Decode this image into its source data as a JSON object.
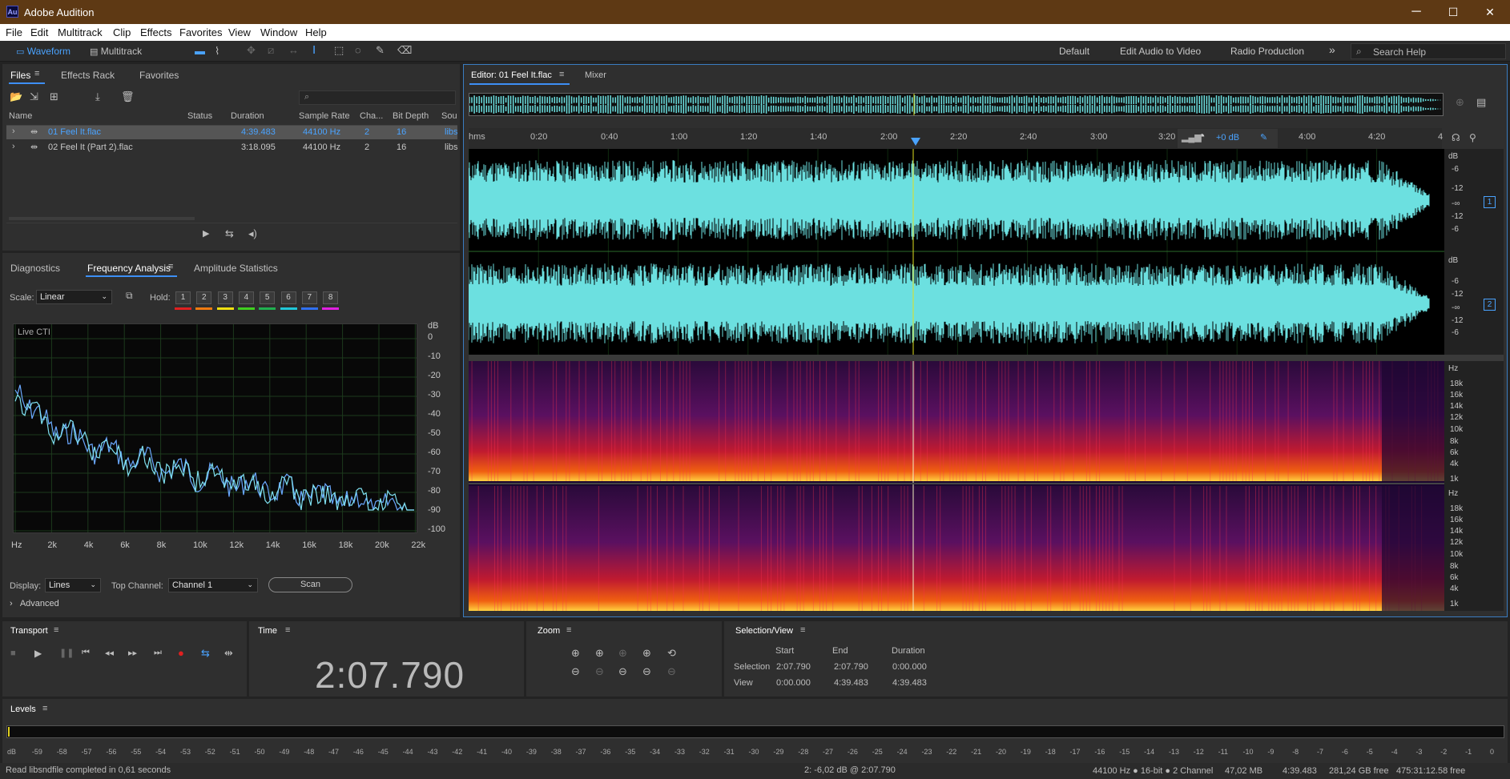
{
  "window": {
    "app_badge": "Au",
    "title": "Adobe Audition",
    "minimize": "─",
    "maximize": "☐",
    "close": "✕"
  },
  "menu": [
    "File",
    "Edit",
    "Multitrack",
    "Clip",
    "Effects",
    "Favorites",
    "View",
    "Window",
    "Help"
  ],
  "toolbar": {
    "waveform": "Waveform",
    "multitrack": "Multitrack",
    "workspaces": [
      "Default",
      "Edit Audio to Video",
      "Radio Production"
    ],
    "more": "»",
    "search_placeholder": "Search Help"
  },
  "files_panel": {
    "tabs": [
      "Files",
      "Effects Rack",
      "Favorites"
    ],
    "columns": [
      "Name",
      "Status",
      "Duration",
      "Sample Rate",
      "Cha...",
      "Bit Depth",
      "Sou"
    ],
    "rows": [
      {
        "name": "01 Feel It.flac",
        "status": "",
        "duration": "4:39.483",
        "rate": "44100 Hz",
        "channels": "2",
        "bits": "16",
        "source": "libs",
        "selected": true
      },
      {
        "name": "02 Feel It (Part 2).flac",
        "status": "",
        "duration": "3:18.095",
        "rate": "44100 Hz",
        "channels": "2",
        "bits": "16",
        "source": "libs",
        "selected": false
      }
    ]
  },
  "analysis_panel": {
    "tabs": [
      "Diagnostics",
      "Frequency Analysis",
      "Amplitude Statistics"
    ],
    "scale_label": "Scale:",
    "scale_value": "Linear",
    "hold_label": "Hold:",
    "hold_buttons": [
      "1",
      "2",
      "3",
      "4",
      "5",
      "6",
      "7",
      "8"
    ],
    "hold_colors": [
      "#e02020",
      "#f07a10",
      "#f0e010",
      "#40d020",
      "#20b050",
      "#20c8d8",
      "#3070f0",
      "#e020e0"
    ],
    "graph_label": "Live CTI",
    "db_unit": "dB",
    "db_ticks": [
      "0",
      "-10",
      "-20",
      "-30",
      "-40",
      "-50",
      "-60",
      "-70",
      "-80",
      "-90",
      "-100"
    ],
    "hz_ticks": [
      "Hz",
      "2k",
      "4k",
      "6k",
      "8k",
      "10k",
      "12k",
      "14k",
      "16k",
      "18k",
      "20k",
      "22k"
    ],
    "display_label": "Display:",
    "display_value": "Lines",
    "top_channel_label": "Top Channel:",
    "top_channel_value": "Channel 1",
    "scan_button": "Scan",
    "advanced": "Advanced"
  },
  "editor": {
    "tab": "Editor: 01 Feel It.flac",
    "mixer_tab": "Mixer",
    "time_ticks": [
      "hms",
      "0:20",
      "0:40",
      "1:00",
      "1:20",
      "1:40",
      "2:00",
      "2:20",
      "2:40",
      "3:00",
      "3:20",
      "4:00",
      "4:20",
      "4"
    ],
    "gain": "+0 dB",
    "db_scale": [
      "dB",
      "-6",
      "-12",
      "-∞",
      "-12",
      "-6"
    ],
    "channels": [
      "1",
      "2"
    ],
    "hz_scale": [
      "Hz",
      "18k",
      "16k",
      "14k",
      "12k",
      "10k",
      "8k",
      "6k",
      "4k",
      "1k"
    ],
    "waveform_color": "#6ce0e0"
  },
  "transport": {
    "title": "Transport"
  },
  "time": {
    "title": "Time",
    "value": "2:07.790"
  },
  "zoom": {
    "title": "Zoom"
  },
  "selection_view": {
    "title": "Selection/View",
    "headers": [
      "Start",
      "End",
      "Duration"
    ],
    "rows": [
      {
        "label": "Selection",
        "start": "2:07.790",
        "end": "2:07.790",
        "duration": "0:00.000"
      },
      {
        "label": "View",
        "start": "0:00.000",
        "end": "4:39.483",
        "duration": "4:39.483"
      }
    ]
  },
  "levels": {
    "title": "Levels",
    "ticks": [
      "dB",
      "-59",
      "-58",
      "-57",
      "-56",
      "-55",
      "-54",
      "-53",
      "-52",
      "-51",
      "-50",
      "-49",
      "-48",
      "-47",
      "-46",
      "-45",
      "-44",
      "-43",
      "-42",
      "-41",
      "-40",
      "-39",
      "-38",
      "-37",
      "-36",
      "-35",
      "-34",
      "-33",
      "-32",
      "-31",
      "-30",
      "-29",
      "-28",
      "-27",
      "-26",
      "-25",
      "-24",
      "-23",
      "-22",
      "-21",
      "-20",
      "-19",
      "-18",
      "-17",
      "-16",
      "-15",
      "-14",
      "-13",
      "-12",
      "-11",
      "-10",
      "-9",
      "-8",
      "-7",
      "-6",
      "-5",
      "-4",
      "-3",
      "-2",
      "-1",
      "0"
    ]
  },
  "status": {
    "message": "Read libsndfile completed in 0,61 seconds",
    "cursor": "2: -6,02 dB @ 2:07.790",
    "format": "44100 Hz ● 16-bit ● 2 Channel",
    "size": "47,02 MB",
    "duration": "4:39.483",
    "free": "281,24 GB free",
    "free_time": "475:31:12.58 free"
  }
}
